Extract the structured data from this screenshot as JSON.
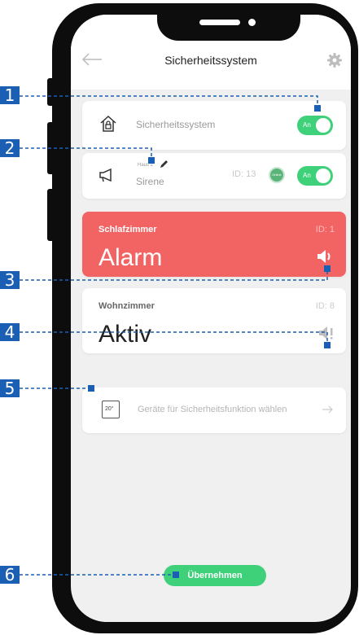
{
  "header": {
    "title": "Sicherheitssystem"
  },
  "security_card": {
    "label": "Sicherheitssystem",
    "toggle_label": "An"
  },
  "siren_card": {
    "location": "Haus 2",
    "name": "Sirene",
    "id_text": "ID: 13",
    "status_badge": "Online",
    "toggle_label": "An"
  },
  "alarm_card": {
    "room": "Schlafzimmer",
    "id_text": "ID: 1",
    "status": "Alarm"
  },
  "living_card": {
    "room": "Wohnzimmer",
    "id_text": "ID: 8",
    "status": "Aktiv"
  },
  "devices_card": {
    "label": "Geräte für Sicherheitsfunktion wählen",
    "icon_text": "20°"
  },
  "apply_button": {
    "label": "Übernehmen"
  },
  "callouts": [
    "1",
    "2",
    "3",
    "4",
    "5",
    "6"
  ],
  "colors": {
    "accent_green": "#3fd17a",
    "alarm_red": "#f26464",
    "callout_blue": "#1b5fb4"
  },
  "icons": [
    "back-arrow-icon",
    "gear-icon",
    "house-lock-icon",
    "megaphone-icon",
    "pencil-icon",
    "speaker-loud-icon",
    "speaker-alert-icon",
    "thermostat-icon",
    "arrow-right-icon"
  ]
}
